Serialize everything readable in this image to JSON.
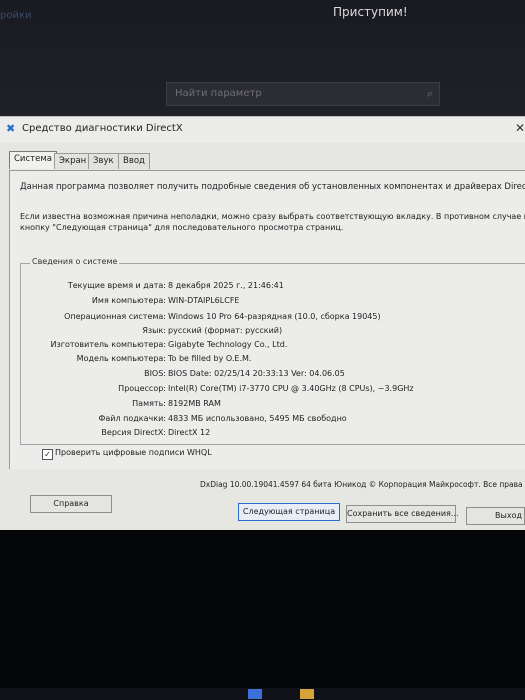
{
  "background": {
    "left_text": "ройки",
    "title": "Приступим!",
    "search_placeholder": "Найти параметр",
    "search_icon": "search-icon"
  },
  "dialog": {
    "title": "Средство диагностики DirectX",
    "tabs": [
      "Система",
      "Экран",
      "Звук",
      "Ввод"
    ],
    "intro": "Данная программа позволяет получить подробные сведения об установленных компонентах и драйверах DirectX.",
    "intro2_line1": "Если известна возможная причина неполадки, можно сразу выбрать соответствующую вкладку. В противном случае испо",
    "intro2_line2": "кнопку \"Следующая страница\" для последовательного просмотра страниц.",
    "group_title": "Сведения о системе",
    "rows": [
      {
        "label": "Текущие время и дата:",
        "value": "8 декабря 2025 г., 21:46:41"
      },
      {
        "label": "Имя компьютера:",
        "value": "WIN-DTAIPL6LCFE"
      },
      {
        "label": "Операционная система:",
        "value": "Windows 10 Pro 64-разрядная (10.0, сборка 19045)"
      },
      {
        "label": "Язык:",
        "value": "русский (формат: русский)"
      },
      {
        "label": "Изготовитель компьютера:",
        "value": "Gigabyte Technology Co., Ltd."
      },
      {
        "label": "Модель компьютера:",
        "value": "To be filled by O.E.M."
      },
      {
        "label": "BIOS:",
        "value": "BIOS Date: 02/25/14 20:33:13 Ver: 04.06.05"
      },
      {
        "label": "Процессор:",
        "value": "Intel(R) Core(TM) i7-3770 CPU @ 3.40GHz (8 CPUs), ~3.9GHz"
      },
      {
        "label": "Память:",
        "value": "8192MB RAM"
      },
      {
        "label": "Файл подкачки:",
        "value": "4833 МБ использовано, 5495 МБ свободно"
      },
      {
        "label": "Версия DirectX:",
        "value": "DirectX 12"
      }
    ],
    "whql_label": "Проверить цифровые подписи WHQL",
    "whql_checked": true,
    "footer": "DxDiag 10.00.19041.4597 64 бита Юникод © Корпорация Майкрософт. Все права заш",
    "buttons": {
      "help": "Справка",
      "next": "Следующая страница",
      "save": "Сохранить все сведения...",
      "exit": "Выход"
    }
  },
  "colors": {
    "accent": "#2a6bd0",
    "dialog_bg": "#e6e6e2",
    "dark_bg": "#0b0c10"
  }
}
